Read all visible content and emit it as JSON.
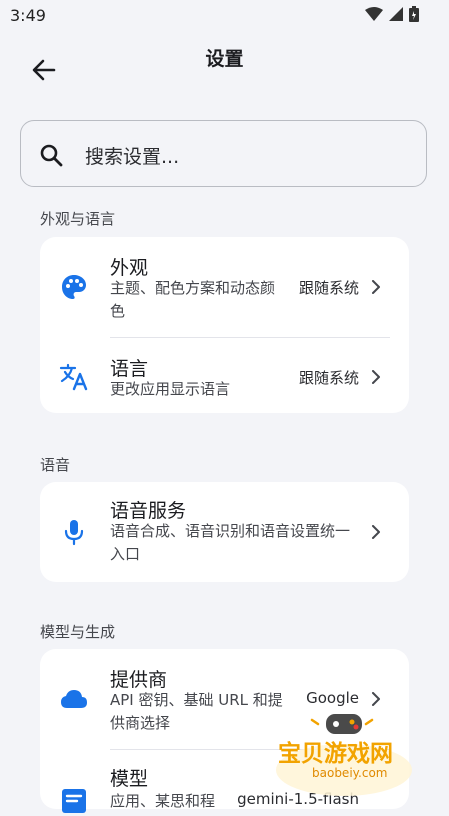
{
  "status_bar": {
    "time": "3:49",
    "icons": [
      "wifi-icon",
      "signal-icon",
      "battery-icon"
    ]
  },
  "header": {
    "title": "设置",
    "back_icon": "arrow-left-icon"
  },
  "search": {
    "placeholder": "搜索设置..."
  },
  "sections": [
    {
      "title": "外观与语言",
      "items": [
        {
          "icon": "palette-icon",
          "title": "外观",
          "subtitle": "主题、配色方案和动态颜色",
          "value": "跟随系统"
        },
        {
          "icon": "translate-icon",
          "title": "语言",
          "subtitle": "更改应用显示语言",
          "value": "跟随系统"
        }
      ]
    },
    {
      "title": "语音",
      "items": [
        {
          "icon": "microphone-icon",
          "title": "语音服务",
          "subtitle": "语音合成、语音识别和语音设置统一入口",
          "value": ""
        }
      ]
    },
    {
      "title": "模型与生成",
      "items": [
        {
          "icon": "cloud-icon",
          "title": "提供商",
          "subtitle": "API 密钥、基础 URL 和提供商选择",
          "value": "Google"
        },
        {
          "icon": "model-icon",
          "title": "模型",
          "subtitle": "应用、某思和程",
          "value": "gemini-1.5-flash"
        }
      ]
    }
  ],
  "colors": {
    "accent": "#1a73e8",
    "background": "#f3f4f8",
    "card": "#ffffff"
  },
  "watermark": {
    "text": "宝贝游戏网",
    "url": "baobeiy.com"
  }
}
